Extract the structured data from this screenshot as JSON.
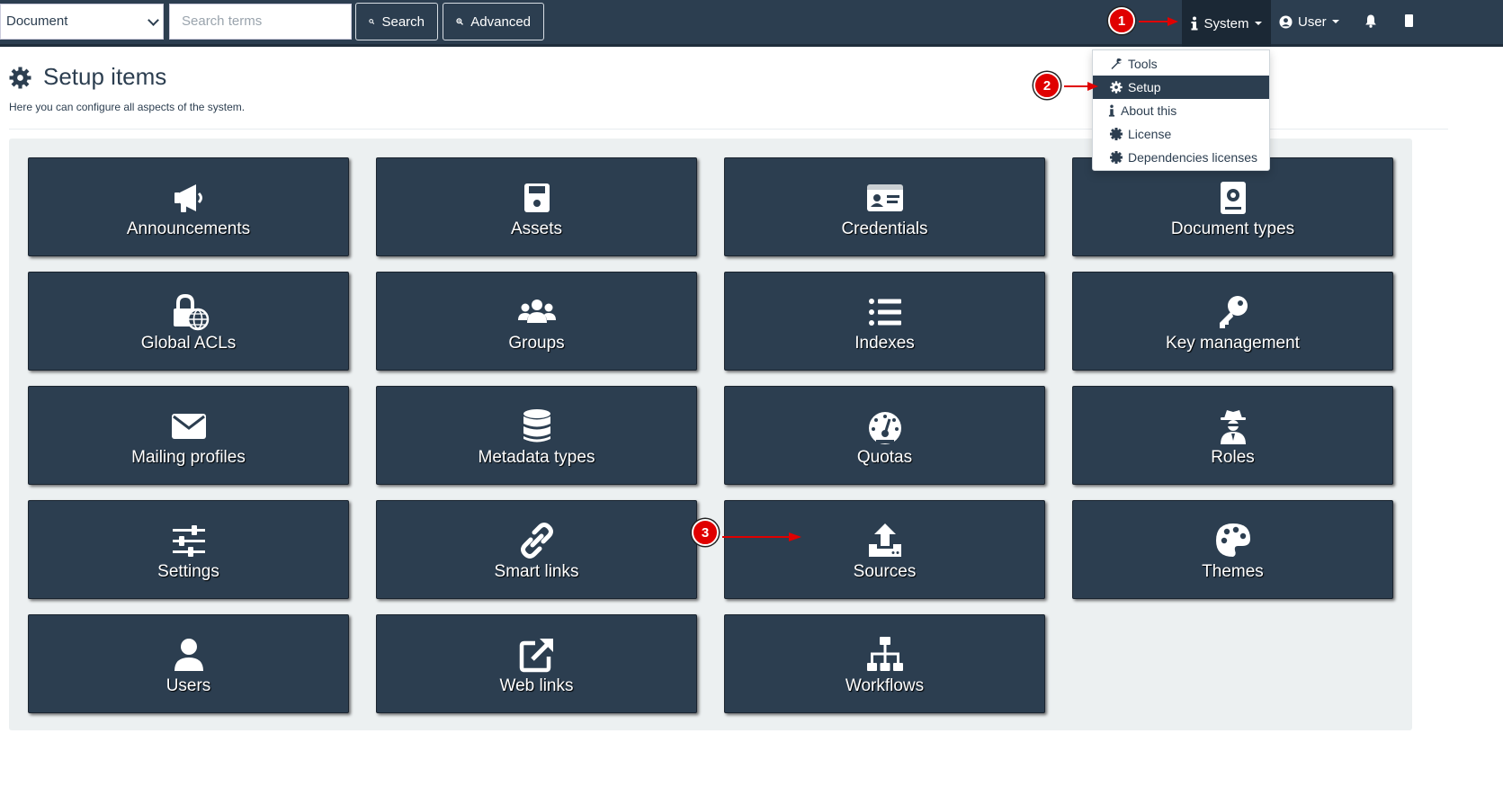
{
  "navbar": {
    "document_select": "Document",
    "search_placeholder": "Search terms",
    "search_button": "Search",
    "advanced_button": "Advanced",
    "system_menu": "System",
    "user_menu": "User"
  },
  "page": {
    "title": "Setup items",
    "subtitle": "Here you can configure all aspects of the system."
  },
  "system_dropdown": {
    "items": [
      {
        "label": "Tools",
        "icon": "wrench-icon",
        "active": false
      },
      {
        "label": "Setup",
        "icon": "gear-icon",
        "active": true
      },
      {
        "label": "About this",
        "icon": "info-icon",
        "active": false
      },
      {
        "label": "License",
        "icon": "certificate-icon",
        "active": false
      },
      {
        "label": "Dependencies licenses",
        "icon": "certificate-icon",
        "active": false
      }
    ]
  },
  "tiles": [
    {
      "label": "Announcements",
      "icon": "megaphone-icon"
    },
    {
      "label": "Assets",
      "icon": "floppy-disk-icon"
    },
    {
      "label": "Credentials",
      "icon": "id-card-icon"
    },
    {
      "label": "Document types",
      "icon": "document-badge-icon"
    },
    {
      "label": "Global ACLs",
      "icon": "lock-globe-icon"
    },
    {
      "label": "Groups",
      "icon": "users-icon"
    },
    {
      "label": "Indexes",
      "icon": "list-icon"
    },
    {
      "label": "Key management",
      "icon": "key-icon"
    },
    {
      "label": "Mailing profiles",
      "icon": "envelope-icon"
    },
    {
      "label": "Metadata types",
      "icon": "database-icon"
    },
    {
      "label": "Quotas",
      "icon": "gauge-icon"
    },
    {
      "label": "Roles",
      "icon": "user-secret-icon"
    },
    {
      "label": "Settings",
      "icon": "sliders-icon"
    },
    {
      "label": "Smart links",
      "icon": "link-icon"
    },
    {
      "label": "Sources",
      "icon": "upload-icon"
    },
    {
      "label": "Themes",
      "icon": "palette-icon"
    },
    {
      "label": "Users",
      "icon": "user-icon"
    },
    {
      "label": "Web links",
      "icon": "external-link-icon"
    },
    {
      "label": "Workflows",
      "icon": "sitemap-icon"
    }
  ],
  "annotations": {
    "step1": "1",
    "step2": "2",
    "step3": "3",
    "color": "#e00000"
  },
  "colors": {
    "navbar": "#2c3e50",
    "tile": "#2c3e50",
    "panel": "#ecf0f1",
    "accent_red": "#e00000"
  }
}
